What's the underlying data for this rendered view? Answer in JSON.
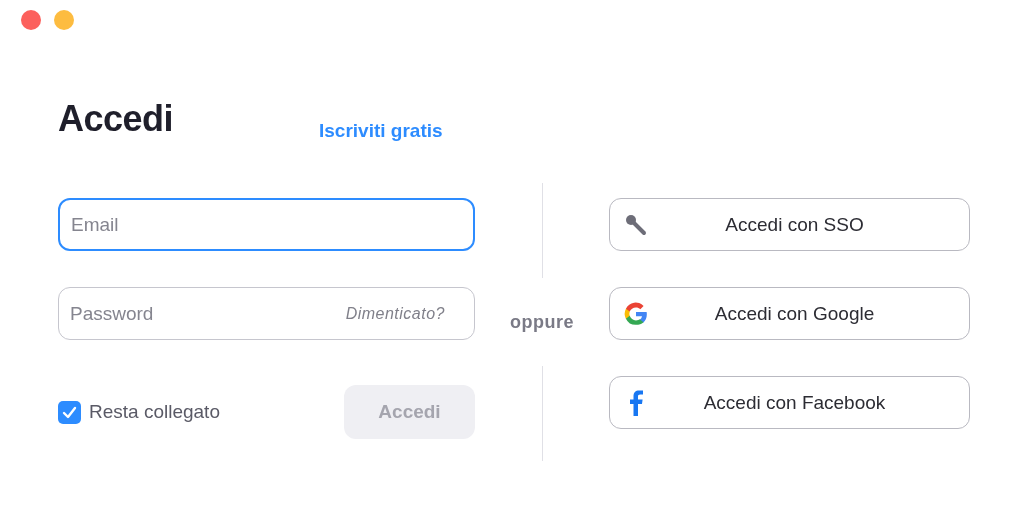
{
  "window_buttons": [
    {
      "color": "#fc605c"
    },
    {
      "color": "#fdbc40"
    }
  ],
  "title": "Accedi",
  "signup_link": "Iscriviti gratis",
  "email": {
    "placeholder": "Email",
    "focused": true
  },
  "password": {
    "placeholder": "Password",
    "forgot_link": "Dimenticato?",
    "focused": false
  },
  "stay_signed_in": {
    "label": "Resta collegato",
    "checked": true
  },
  "submit": {
    "label": "Accedi",
    "disabled": true
  },
  "separator": "oppure",
  "providers": [
    {
      "kind": "sso",
      "label": "Accedi con SSO"
    },
    {
      "kind": "google",
      "label": "Accedi con Google"
    },
    {
      "kind": "facebook",
      "label": "Accedi con Facebook"
    }
  ]
}
